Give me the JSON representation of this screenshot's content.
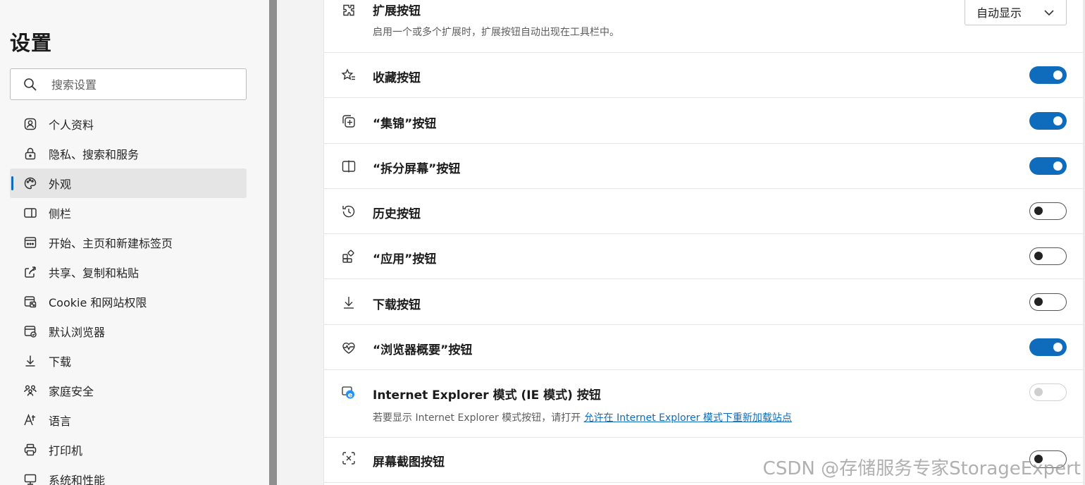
{
  "sidebar": {
    "title": "设置",
    "search_placeholder": "搜索设置",
    "items": [
      {
        "label": "个人资料",
        "icon": "profile-icon"
      },
      {
        "label": "隐私、搜索和服务",
        "icon": "lock-icon"
      },
      {
        "label": "外观",
        "icon": "palette-icon",
        "active": true
      },
      {
        "label": "侧栏",
        "icon": "sidebar-icon"
      },
      {
        "label": "开始、主页和新建标签页",
        "icon": "home-tab-icon"
      },
      {
        "label": "共享、复制和粘贴",
        "icon": "share-icon"
      },
      {
        "label": "Cookie 和网站权限",
        "icon": "cookie-icon"
      },
      {
        "label": "默认浏览器",
        "icon": "browser-icon"
      },
      {
        "label": "下载",
        "icon": "download-icon"
      },
      {
        "label": "家庭安全",
        "icon": "family-icon"
      },
      {
        "label": "语言",
        "icon": "language-icon"
      },
      {
        "label": "打印机",
        "icon": "printer-icon"
      },
      {
        "label": "系统和性能",
        "icon": "system-icon"
      }
    ]
  },
  "content": {
    "rows": [
      {
        "label": "扩展按钮",
        "description": "启用一个或多个扩展时，扩展按钮自动出现在工具栏中。",
        "control": "dropdown",
        "value": "自动显示",
        "icon": "extensions-icon"
      },
      {
        "label": "收藏按钮",
        "control": "toggle",
        "state": "on",
        "icon": "favorites-icon"
      },
      {
        "label": "“集锦”按钮",
        "control": "toggle",
        "state": "on",
        "icon": "collections-icon"
      },
      {
        "label": "“拆分屏幕”按钮",
        "control": "toggle",
        "state": "on",
        "icon": "split-screen-icon"
      },
      {
        "label": "历史按钮",
        "control": "toggle",
        "state": "off",
        "icon": "history-icon"
      },
      {
        "label": "“应用”按钮",
        "control": "toggle",
        "state": "off",
        "icon": "apps-icon"
      },
      {
        "label": "下载按钮",
        "control": "toggle",
        "state": "off",
        "icon": "download-icon"
      },
      {
        "label": "“浏览器概要”按钮",
        "control": "toggle",
        "state": "on",
        "icon": "browser-essentials-icon"
      },
      {
        "label": "Internet Explorer 模式 (IE 模式) 按钮",
        "description_prefix": "若要显示 Internet Explorer 模式按钮，请打开 ",
        "description_link": "允许在 Internet Explorer 模式下重新加载站点",
        "control": "toggle",
        "state": "disabled",
        "icon": "ie-icon"
      },
      {
        "label": "屏幕截图按钮",
        "control": "toggle",
        "state": "off",
        "icon": "screenshot-icon"
      }
    ]
  },
  "watermark": "CSDN @存储服务专家StorageExpert",
  "colors": {
    "accent": "#0f6cbd",
    "nav_active_bg": "#e5e5e5"
  }
}
